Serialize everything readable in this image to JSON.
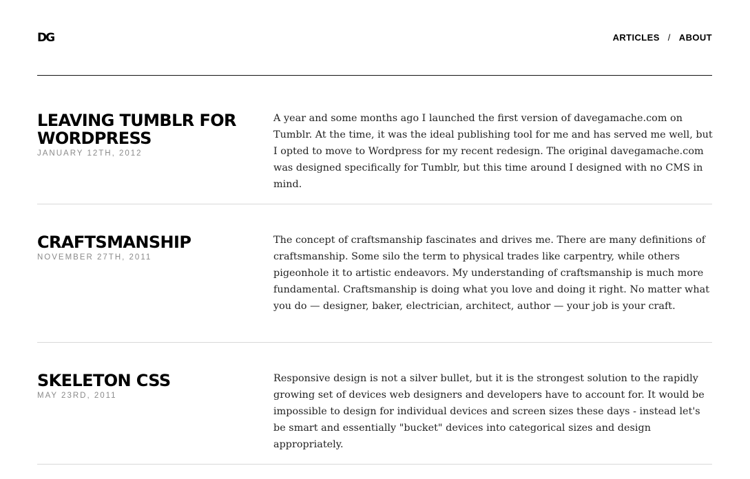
{
  "header": {
    "logo": "DG",
    "nav": [
      {
        "label": "ARTICLES"
      },
      {
        "label": "ABOUT"
      }
    ],
    "separator": "/"
  },
  "articles": [
    {
      "title": "LEAVING TUMBLR FOR WORDPRESS",
      "date": "JANUARY 12TH, 2012",
      "excerpt": "A year and some months ago I launched the first version of davegamache.com on Tumblr. At the time, it was the ideal publishing tool for me and has served me well, but I opted to move to Wordpress for my recent redesign. The original davegamache.com was designed specifically for Tumblr, but this time around I designed with no CMS in mind."
    },
    {
      "title": "CRAFTSMANSHIP",
      "date": "NOVEMBER 27TH, 2011",
      "excerpt": "The concept of craftsmanship fascinates and drives me. There are many definitions of craftsmanship. Some silo the term to physical trades like carpentry, while others pigeonhole it to artistic endeavors. My understanding of craftsmanship is much more fundamental. Craftsmanship is doing what you love and doing it right. No matter what you do — designer, baker, electrician, architect, author — your job is your craft."
    },
    {
      "title": "SKELETON CSS",
      "date": "MAY 23RD, 2011",
      "excerpt": "Responsive design is not a silver bullet, but it is the strongest solution to the rapidly growing set of devices web designers and developers have to account for. It would be impossible to design for individual devices and screen sizes these days - instead let's be smart and essentially \"bucket\" devices into categorical sizes and design appropriately."
    }
  ]
}
